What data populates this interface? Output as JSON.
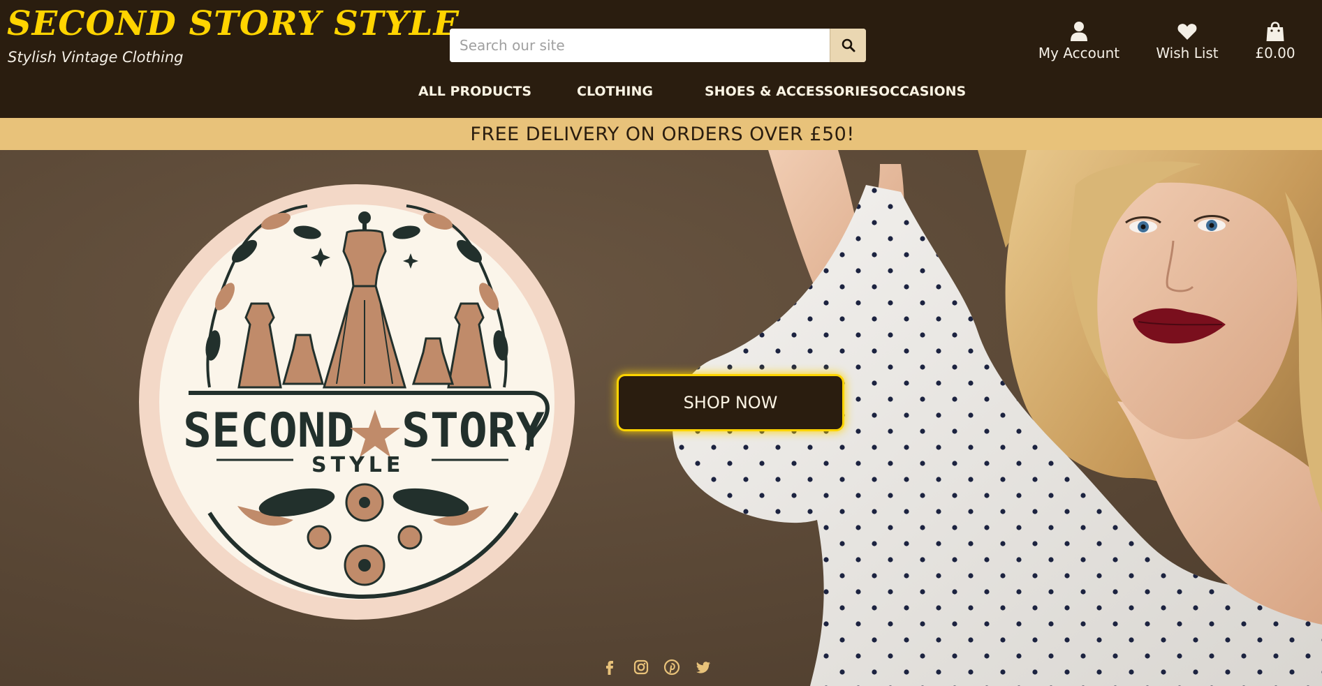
{
  "header": {
    "brand_title": "SECOND STORY STYLE",
    "brand_tagline": "Stylish Vintage Clothing",
    "search": {
      "placeholder": "Search our site",
      "value": "",
      "button_icon": "search-icon"
    },
    "utility": [
      {
        "label": "My Account",
        "icon": "user-icon"
      },
      {
        "label": "Wish List",
        "icon": "heart-icon"
      },
      {
        "label": "£0.00",
        "icon": "shopping-bag-icon"
      }
    ],
    "nav": [
      "ALL PRODUCTS",
      "CLOTHING",
      "SHOES & ACCESSORIES",
      "OCCASIONS"
    ]
  },
  "promo": {
    "text": "FREE DELIVERY ON ORDERS OVER £50!"
  },
  "hero": {
    "logo": {
      "line1_left": "SECOND",
      "line1_right": "STORY",
      "line2": "STYLE"
    },
    "cta_label": "SHOP NOW"
  },
  "social": [
    "facebook-icon",
    "instagram-icon",
    "pinterest-icon",
    "twitter-icon"
  ],
  "colors": {
    "header_bg": "#2a1d0f",
    "brand_yellow": "#ffd400",
    "promo_bg": "#e8c27a",
    "hero_bg": "#5c4a38",
    "social_icon": "#e8c27a"
  }
}
